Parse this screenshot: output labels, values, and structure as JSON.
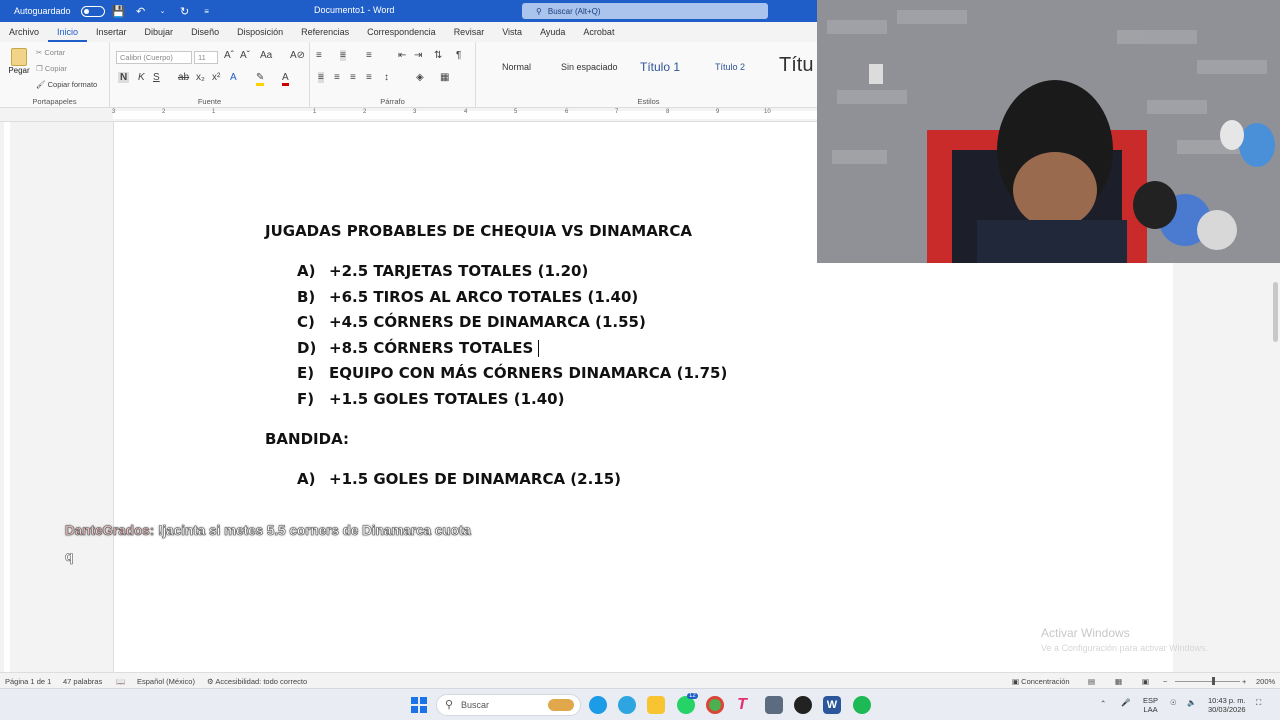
{
  "titlebar": {
    "autosave_label": "Autoguardado",
    "doc_title": "Documento1 - Word",
    "search_placeholder": "Buscar (Alt+Q)"
  },
  "ribbon": {
    "tabs": [
      "Archivo",
      "Inicio",
      "Insertar",
      "Dibujar",
      "Diseño",
      "Disposición",
      "Referencias",
      "Correspondencia",
      "Revisar",
      "Vista",
      "Ayuda",
      "Acrobat"
    ],
    "active_tab": "Inicio",
    "clipboard": {
      "paste": "Pegar",
      "cut": "Cortar",
      "copy": "Copiar",
      "format_painter": "Copiar formato",
      "label": "Portapapeles"
    },
    "font": {
      "name": "Calibri (Cuerpo)",
      "size": "11",
      "label": "Fuente"
    },
    "paragraph": {
      "label": "Párrafo"
    },
    "styles": {
      "items": [
        "Normal",
        "Sin espaciado",
        "Título 1",
        "Título 2",
        "Títu"
      ],
      "label": "Estilos"
    }
  },
  "document": {
    "heading": "JUGADAS PROBABLES DE CHEQUIA VS DINAMARCA",
    "list": [
      {
        "letter": "A)",
        "text": "+2.5 TARJETAS TOTALES (1.20)"
      },
      {
        "letter": "B)",
        "text": "+6.5 TIROS AL ARCO TOTALES (1.40)"
      },
      {
        "letter": "C)",
        "text": "+4.5 CÓRNERS DE DINAMARCA (1.55)"
      },
      {
        "letter": "D)",
        "text": "+8.5 CÓRNERS TOTALES"
      },
      {
        "letter": "E)",
        "text": "EQUIPO CON MÁS CÓRNERS DINAMARCA (1.75)"
      },
      {
        "letter": "F)",
        "text": "+1.5 GOLES TOTALES (1.40)"
      }
    ],
    "bandida_heading": "BANDIDA:",
    "bandida_list": [
      {
        "letter": "A)",
        "text": "+1.5 GOLES DE DINAMARCA (2.15)"
      }
    ]
  },
  "chat": {
    "user": "DanteGrados:",
    "message": "!jacinta si metes 5.5 corners de Dinamarca cuota",
    "continuation": "q"
  },
  "watermark": {
    "title": "Activar Windows",
    "subtitle": "Ve a Configuración para activar Windows."
  },
  "statusbar": {
    "page": "Página 1 de 1",
    "words": "47 palabras",
    "language": "Español (México)",
    "accessibility": "Accesibilidad: todo correcto",
    "focus": "Concentración",
    "zoom": "200%"
  },
  "taskbar": {
    "search": "Buscar",
    "lang": "ESP",
    "region": "LAA",
    "time": "10:43 p. m.",
    "date": "30/03/2026",
    "whatsapp_badge": "12"
  },
  "colors": {
    "title_bar": "#1f5ec8",
    "accent": "#1f5ec8"
  }
}
